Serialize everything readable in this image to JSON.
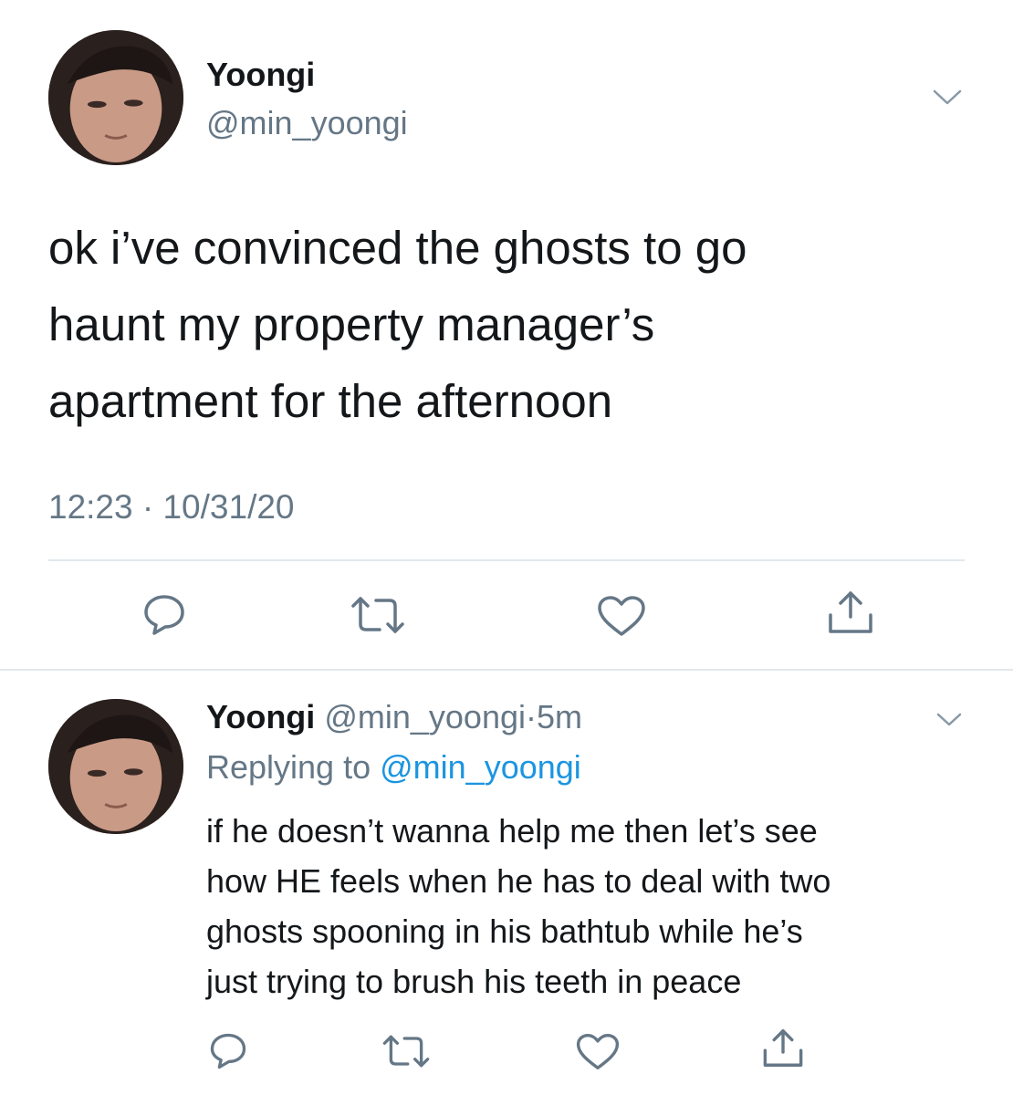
{
  "main_tweet": {
    "author_name": "Yoongi",
    "handle": "@min_yoongi",
    "text_lines": [
      "ok i’ve convinced the ghosts to go",
      "haunt my property manager’s",
      "apartment for the afternoon"
    ],
    "time": "12:23",
    "separator": "·",
    "date": "10/31/20"
  },
  "reply_tweet": {
    "author_name": "Yoongi",
    "handle": "@min_yoongi",
    "separator": "·",
    "age": "5m",
    "replying_label": "Replying to",
    "replying_handle": "@min_yoongi",
    "text_lines": [
      "if he doesn’t wanna help me then let’s see",
      "how HE feels when he has to deal with two",
      "ghosts spooning in his bathtub while he’s",
      "just trying to brush his teeth in peace"
    ]
  },
  "icons": {
    "actions": [
      "reply-icon",
      "retweet-icon",
      "like-icon",
      "share-icon"
    ],
    "menu": "chevron-down-icon"
  },
  "colors": {
    "text": "#14171a",
    "muted": "#657786",
    "link": "#1b95e0",
    "divider": "#e1e8ed"
  }
}
